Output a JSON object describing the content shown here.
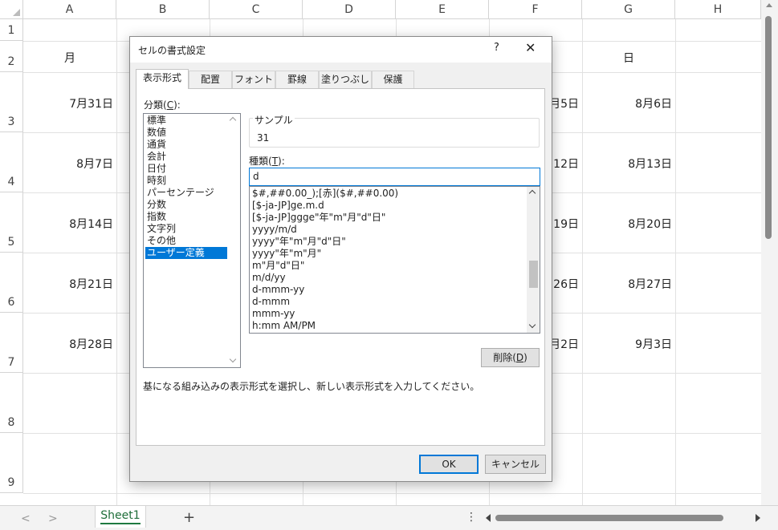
{
  "sheet": {
    "columns": [
      "A",
      "B",
      "C",
      "D",
      "E",
      "F",
      "G",
      "H"
    ],
    "rows": [
      "1",
      "2",
      "3",
      "4",
      "5",
      "6",
      "7",
      "8",
      "9"
    ],
    "cells": {
      "a2": "月",
      "g2": "日",
      "a3": "7月31日",
      "f3": "月5日",
      "g3": "8月6日",
      "a4": "8月7日",
      "f4": "12日",
      "g4": "8月13日",
      "a5": "8月14日",
      "f5": "19日",
      "g5": "8月20日",
      "a6": "8月21日",
      "f6": "26日",
      "g6": "8月27日",
      "a7": "8月28日",
      "f7": "月2日",
      "g7": "9月3日"
    }
  },
  "bottombar": {
    "prev_label": "<",
    "next_label": ">",
    "sheet_tab": "Sheet1",
    "add_label": "+",
    "more_label": "⋮"
  },
  "dialog": {
    "title": "セルの書式設定",
    "help_label": "?",
    "close_label": "✕",
    "tabs": [
      "表示形式",
      "配置",
      "フォント",
      "罫線",
      "塗りつぶし",
      "保護"
    ],
    "category_label": "分類(",
    "category_key": "C",
    "category_suffix": "):",
    "categories": [
      "標準",
      "数値",
      "通貨",
      "会計",
      "日付",
      "時刻",
      "パーセンテージ",
      "分数",
      "指数",
      "文字列",
      "その他",
      "ユーザー定義"
    ],
    "sample_label": "サンプル",
    "sample_value": "31",
    "type_label": "種類(",
    "type_key": "T",
    "type_suffix": "):",
    "type_value": "d",
    "formats": [
      "$#,##0.00_);[赤]($#,##0.00)",
      "[$-ja-JP]ge.m.d",
      "[$-ja-JP]ggge\"年\"m\"月\"d\"日\"",
      "yyyy/m/d",
      "yyyy\"年\"m\"月\"d\"日\"",
      "yyyy\"年\"m\"月\"",
      "m\"月\"d\"日\"",
      "m/d/yy",
      "d-mmm-yy",
      "d-mmm",
      "mmm-yy",
      "h:mm AM/PM"
    ],
    "delete_label": "削除(",
    "delete_key": "D",
    "delete_suffix": ")",
    "description": "基になる組み込みの表示形式を選択し、新しい表示形式を入力してください。",
    "ok_label": "OK",
    "cancel_label": "キャンセル"
  }
}
